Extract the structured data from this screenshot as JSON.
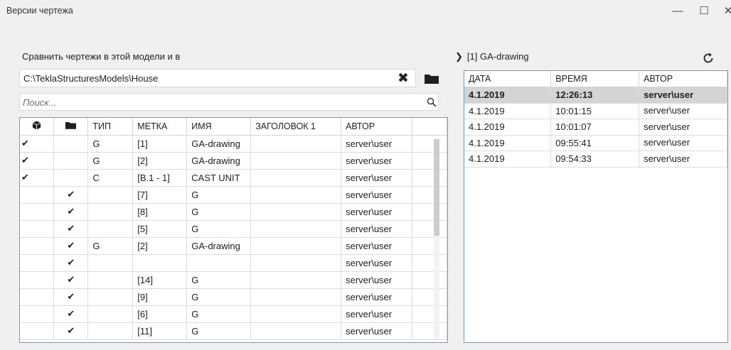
{
  "window": {
    "title": "Версии чертежа",
    "min_glyph": "—",
    "max_glyph": "☐",
    "close_glyph": "✕"
  },
  "compare": {
    "label": "Сравнить чертежи в этой модели и в",
    "path_value": "C:\\TeklaStructuresModels\\House",
    "clear_glyph": "✖",
    "folder_icon": "folder-icon"
  },
  "search": {
    "placeholder": "Поиск...",
    "value": "",
    "icon": "search-icon"
  },
  "left_table": {
    "headers": [
      "",
      "",
      "ТИП",
      "МЕТКА",
      "ИМЯ",
      "ЗАГОЛОВОК 1",
      "АВТОР"
    ],
    "header_icons": [
      "model-cube-icon",
      "folder-icon"
    ],
    "check_glyph": "✔",
    "rows": [
      {
        "in_model": true,
        "in_folder": false,
        "type": "G",
        "mark": "[1]",
        "name": "GA-drawing",
        "title1": "",
        "author": "server\\user"
      },
      {
        "in_model": true,
        "in_folder": false,
        "type": "G",
        "mark": "[2]",
        "name": "GA-drawing",
        "title1": "",
        "author": "server\\user"
      },
      {
        "in_model": true,
        "in_folder": false,
        "type": "C",
        "mark": "[B.1 - 1]",
        "name": "CAST UNIT",
        "title1": "",
        "author": "server\\user"
      },
      {
        "in_model": false,
        "in_folder": true,
        "type": "",
        "mark": "[7]",
        "name": "G",
        "title1": "",
        "author": "server\\user"
      },
      {
        "in_model": false,
        "in_folder": true,
        "type": "",
        "mark": "[8]",
        "name": "G",
        "title1": "",
        "author": "server\\user"
      },
      {
        "in_model": false,
        "in_folder": true,
        "type": "",
        "mark": "[5]",
        "name": "G",
        "title1": "",
        "author": "server\\user"
      },
      {
        "in_model": false,
        "in_folder": true,
        "type": "G",
        "mark": "[2]",
        "name": "GA-drawing",
        "title1": "",
        "author": "server\\user"
      },
      {
        "in_model": false,
        "in_folder": true,
        "type": "",
        "mark": "",
        "name": "",
        "title1": "",
        "author": "server\\user"
      },
      {
        "in_model": false,
        "in_folder": true,
        "type": "",
        "mark": "[14]",
        "name": "G",
        "title1": "",
        "author": "server\\user"
      },
      {
        "in_model": false,
        "in_folder": true,
        "type": "",
        "mark": "[9]",
        "name": "G",
        "title1": "",
        "author": "server\\user"
      },
      {
        "in_model": false,
        "in_folder": true,
        "type": "",
        "mark": "[6]",
        "name": "G",
        "title1": "",
        "author": "server\\user"
      },
      {
        "in_model": false,
        "in_folder": true,
        "type": "",
        "mark": "[11]",
        "name": "G",
        "title1": "",
        "author": "server\\user"
      }
    ]
  },
  "versions": {
    "expand_glyph": "❯",
    "header": "[1] GA-drawing",
    "refresh_icon": "refresh-icon",
    "headers": [
      "ДАТА",
      "ВРЕМЯ",
      "АВТОР"
    ],
    "rows": [
      {
        "date": "4.1.2019",
        "time": "12:26:13",
        "author": "server\\user",
        "current": true
      },
      {
        "date": "4.1.2019",
        "time": "10:01:15",
        "author": "server\\user",
        "current": false
      },
      {
        "date": "4.1.2019",
        "time": "10:01:07",
        "author": "server\\user",
        "current": false
      },
      {
        "date": "4.1.2019",
        "time": "09:55:41",
        "author": "server\\user",
        "current": false
      },
      {
        "date": "4.1.2019",
        "time": "09:54:33",
        "author": "server\\user",
        "current": false
      }
    ]
  },
  "colors": {
    "window_bg": "#f0f0f0",
    "grid_border": "#7d99b8",
    "selected_row_bg": "#d4d4d4"
  }
}
